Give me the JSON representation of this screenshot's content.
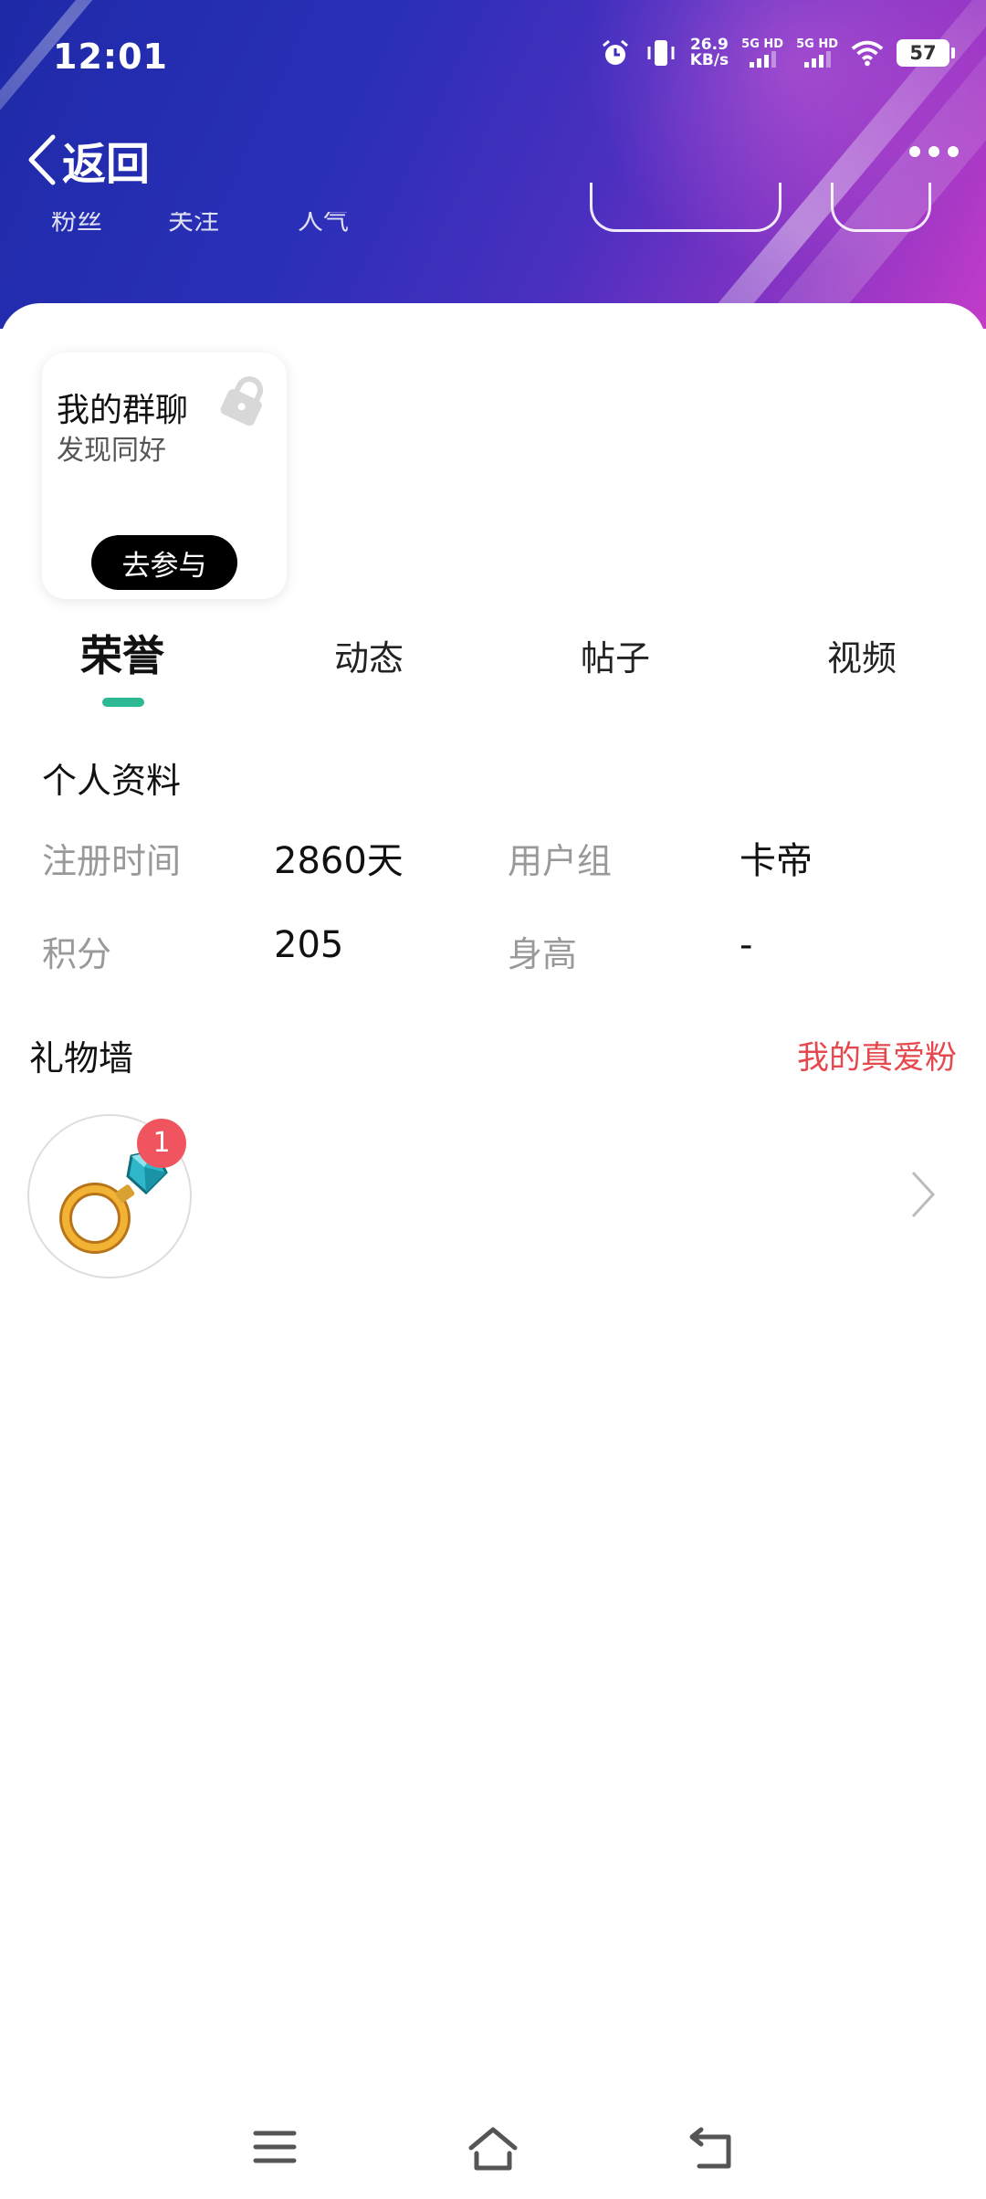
{
  "status_bar": {
    "time": "12:01",
    "net_speed_value": "26.9",
    "net_speed_unit": "KB/s",
    "sim1_label": "5G HD",
    "sim2_label": "5G HD",
    "battery": "57"
  },
  "nav": {
    "back_label": "返回"
  },
  "header_stats": {
    "fans": "粉丝",
    "follow": "关注",
    "popularity": "人气"
  },
  "group_card": {
    "title": "我的群聊",
    "subtitle": "发现同好",
    "button": "去参与"
  },
  "tabs": [
    "荣誉",
    "动态",
    "帖子",
    "视频"
  ],
  "profile": {
    "section_title": "个人资料",
    "rows": [
      {
        "label": "注册时间",
        "value": "2860天",
        "label2": "用户组",
        "value2": "卡帝"
      },
      {
        "label": "积分",
        "value": "205",
        "label2": "身高",
        "value2": "-"
      }
    ]
  },
  "gift_wall": {
    "title": "礼物墙",
    "link": "我的真爱粉",
    "badge_count": "1",
    "gift_icon": "diamond-ring-icon"
  },
  "colors": {
    "accent": "#2db894",
    "link_red": "#e5484d",
    "badge_red": "#f0555f"
  }
}
